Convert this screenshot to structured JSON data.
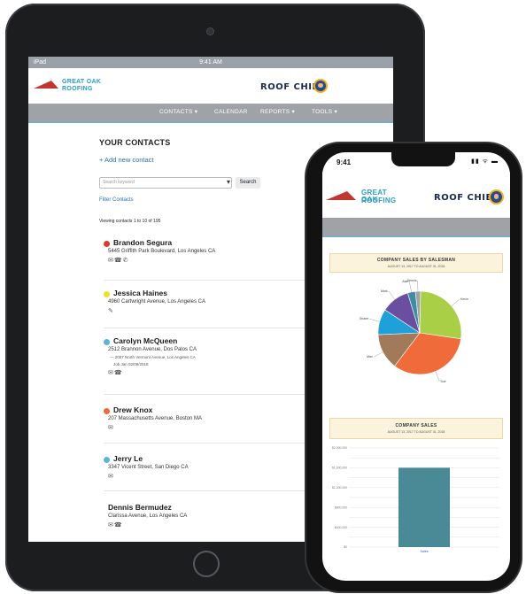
{
  "tablet": {
    "status": {
      "device": "iPad",
      "time": "9:41 AM"
    },
    "header": {
      "logo_line1": "GREAT OAK",
      "logo_line2": "ROOFING",
      "brand": "ROOF CHIEF"
    },
    "nav": [
      "CONTACTS ▾",
      "CALENDAR",
      "REPORTS ▾",
      "TOOLS ▾"
    ],
    "page": {
      "title": "YOUR CONTACTS",
      "add_link": "+ Add new contact",
      "search_placeholder": "Search keyword",
      "search_button": "Search",
      "filter_link": "Filter Contacts",
      "viewing": "Viewing contacts 1 to 10 of 195"
    },
    "contacts": [
      {
        "name": "Brandon Segura",
        "address": "5445 Griffith Park Boulevard, Los Angeles CA",
        "color": "#d93a2e",
        "icons": "✉☎✆"
      },
      {
        "name": "Jessica Haines",
        "address": "4960 Cartwright Avenue, Los Angeles CA",
        "color": "#f0e02a",
        "icons": "✎"
      },
      {
        "name": "Carolyn McQueen",
        "address": "2512 Brannon Avenue, Dos Palos CA",
        "color": "#5bb5d8",
        "icons": "✉☎",
        "extra1": "— 2007 North Vermont Avenue, Los Angeles CA",
        "extra2": "Job Jan 02/09/2018"
      },
      {
        "name": "Drew Knox",
        "address": "207 Massachusetts Avenue, Boston MA",
        "color": "#ee6a3a",
        "icons": "✉"
      },
      {
        "name": "Jerry Le",
        "address": "3347 Vicent Street, San Diego CA",
        "color": "#5bb5d8",
        "icons": "✉"
      },
      {
        "name": "Dennis Bermudez",
        "address": "Clarissa Avenue, Los Angeles CA",
        "color": "",
        "icons": "✉☎"
      }
    ]
  },
  "phone": {
    "status": {
      "time": "9:41",
      "indicators": "▮▮ ᯤ ▬"
    },
    "header": {
      "logo_line1": "GREAT OAK",
      "logo_line2": "ROOFING",
      "brand": "ROOF CHIEF"
    },
    "pie_chart": {
      "title": "COMPANY SALES BY SALESMAN",
      "subtitle": "AUGUST 13, 2017 TO AUGUST 31, 2018"
    },
    "bar_chart": {
      "title": "COMPANY SALES",
      "subtitle": "AUGUST 13, 2017 TO AUGUST 31, 2018"
    }
  },
  "chart_data": [
    {
      "type": "pie",
      "title": "COMPANY SALES BY SALESMAN",
      "subtitle": "AUGUST 13, 2017 TO AUGUST 31, 2018",
      "slices": [
        {
          "label": "Kevin",
          "value": 27,
          "color": "#a8cf45"
        },
        {
          "label": "Sue",
          "value": 33,
          "color": "#f06b3a"
        },
        {
          "label": "Max",
          "value": 14,
          "color": "#a07a5a"
        },
        {
          "label": "Shane",
          "value": 10,
          "color": "#1fa0d8"
        },
        {
          "label": "Mark",
          "value": 11,
          "color": "#6a4fa0"
        },
        {
          "label": "Alan",
          "value": 3,
          "color": "#3c8ea0"
        },
        {
          "label": "Dennis",
          "value": 2,
          "color": "#9fa3a8"
        }
      ]
    },
    {
      "type": "bar",
      "title": "COMPANY SALES",
      "subtitle": "AUGUST 13, 2017 TO AUGUST 31, 2018",
      "categories": [
        "Sales"
      ],
      "values": [
        1600000
      ],
      "color": "#4a8a96",
      "ylim": [
        0,
        2000000
      ],
      "yticks": [
        "$0",
        "$200,000",
        "$400,000",
        "$600,000",
        "$800,000",
        "$1,000,000",
        "$1,200,000",
        "$1,400,000",
        "$1,600,000",
        "$1,800,000",
        "$2,000,000"
      ]
    }
  ]
}
